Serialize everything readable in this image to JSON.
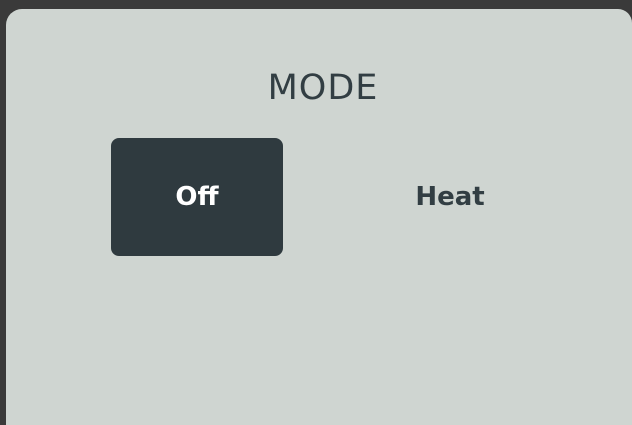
{
  "mode_panel": {
    "title": "MODE",
    "options": [
      {
        "label": "Off",
        "selected": true
      },
      {
        "label": "Heat",
        "selected": false
      }
    ]
  },
  "colors": {
    "panel_background": "#cfd5d1",
    "selected_background": "#2f3a3f",
    "text_dark": "#323e43",
    "text_light": "#ffffff",
    "frame": "#3a3a3a"
  }
}
